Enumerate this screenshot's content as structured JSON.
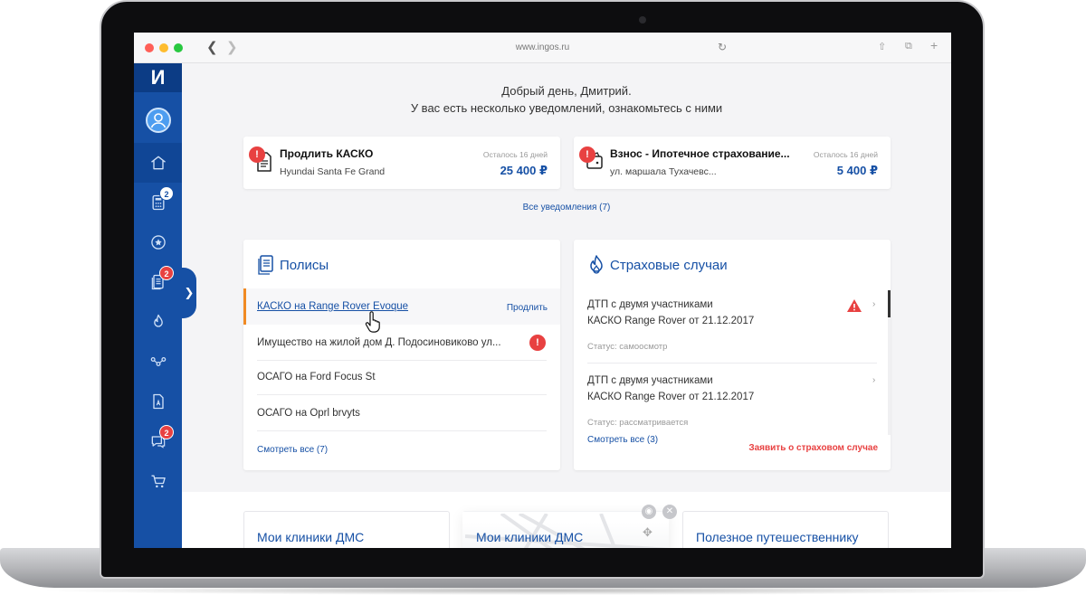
{
  "browser": {
    "url": "www.ingos.ru",
    "back_icon": "chevron-left-icon",
    "forward_icon": "chevron-right-icon"
  },
  "sidebar": {
    "logo": "И",
    "items": [
      {
        "name": "home",
        "icon": "house-icon",
        "badge": ""
      },
      {
        "name": "calculator",
        "icon": "calculator-icon",
        "badge": "2"
      },
      {
        "name": "favorites",
        "icon": "star-icon",
        "badge": ""
      },
      {
        "name": "policies",
        "icon": "document-icon",
        "badge": "2"
      },
      {
        "name": "insurance-cases",
        "icon": "flame-icon",
        "badge": ""
      },
      {
        "name": "services",
        "icon": "nodes-icon",
        "badge": ""
      },
      {
        "name": "documents",
        "icon": "file-icon",
        "badge": ""
      },
      {
        "name": "chat",
        "icon": "chat-icon",
        "badge": "2"
      },
      {
        "name": "cart",
        "icon": "cart-icon",
        "badge": ""
      }
    ]
  },
  "greeting": {
    "line1": "Добрый день, Дмитрий.",
    "line2": "У вас есть несколько уведомлений, ознакомьтесь с ними"
  },
  "notifications": [
    {
      "title": "Продлить КАСКО",
      "subtitle": "Hyundai  Santa Fe Grand",
      "remaining": "Осталось 16 дней",
      "amount": "25 400 ₽"
    },
    {
      "title": "Взнос - Ипотечное страхование...",
      "subtitle": "ул. маршала Тухачевс...",
      "remaining": "Осталось 16 дней",
      "amount": "5 400 ₽"
    }
  ],
  "all_notifications": "Все уведомления (7)",
  "policies": {
    "title": "Полисы",
    "renew_label": "Продлить",
    "items": [
      "КАСКО на Range Rover Evoque",
      "Имущество на жилой дом Д. Подосиновиково ул...",
      "ОСАГО на Ford Focus St",
      "ОСАГО на Oprl brvyts"
    ],
    "see_all": "Смотреть все (7)"
  },
  "cases": {
    "title": "Страховые случаи",
    "items": [
      {
        "line1": "ДТП с двумя участниками",
        "line2": "КАСКО Range Rover от 21.12.2017",
        "status": "Статус: самоосмотр"
      },
      {
        "line1": "ДТП с двумя участниками",
        "line2": "КАСКО Range Rover от 21.12.2017",
        "status": "Статус: рассматривается"
      }
    ],
    "see_all": "Смотреть все (3)",
    "report": "Заявить о страховом случае"
  },
  "lower_cards": [
    {
      "title": "Мои клиники ДМС"
    },
    {
      "title": "Мои клиники ДМС"
    },
    {
      "title": "Полезное путешественнику"
    }
  ],
  "colors": {
    "brand": "#1650a5",
    "alert": "#e84141",
    "accent": "#f08a24"
  }
}
